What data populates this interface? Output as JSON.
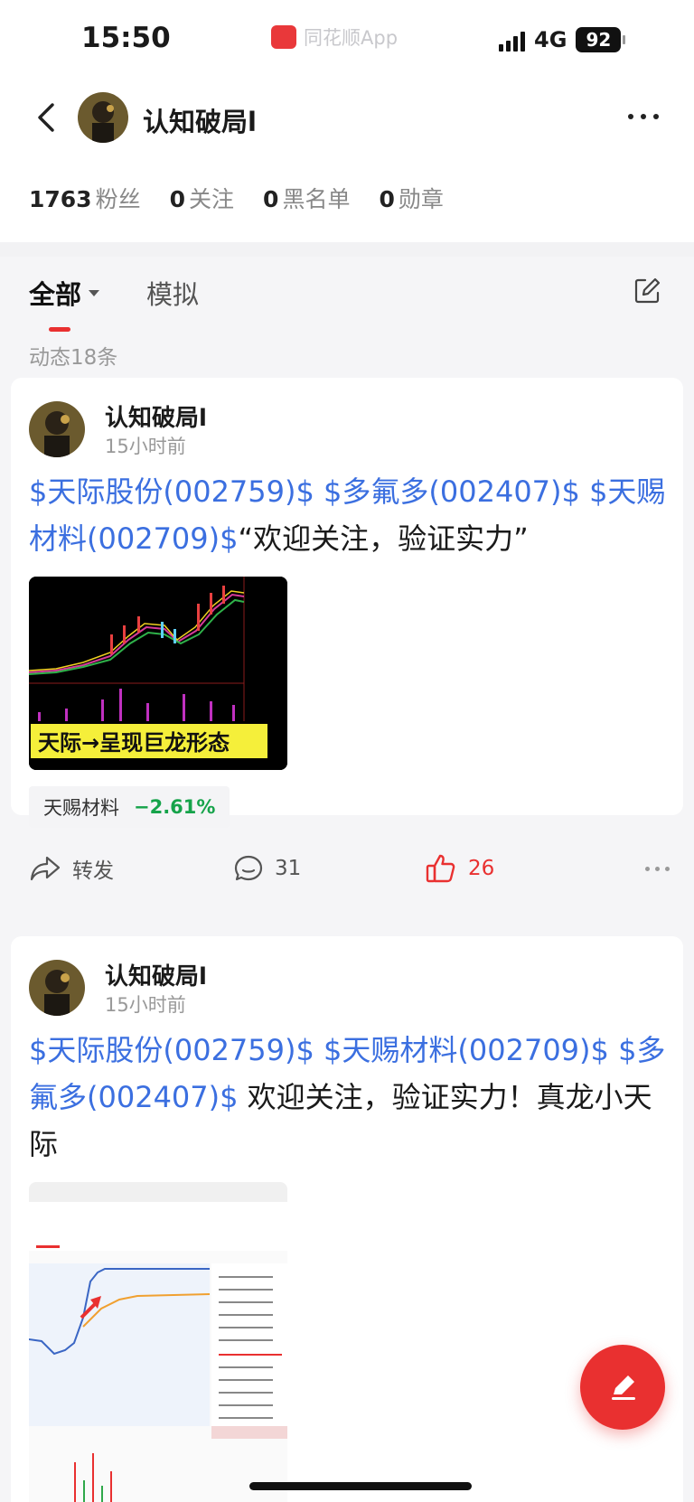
{
  "status_bar": {
    "time": "15:50",
    "app_label": "同花顺App",
    "network": "4G",
    "battery": "92"
  },
  "profile": {
    "name": "认知破局l",
    "stats": [
      {
        "value": "1763",
        "label": "粉丝"
      },
      {
        "value": "0",
        "label": "关注"
      },
      {
        "value": "0",
        "label": "黑名单"
      },
      {
        "value": "0",
        "label": "勋章"
      }
    ]
  },
  "tabs": {
    "all": "全部",
    "simulate": "模拟"
  },
  "feed_count": "动态18条",
  "posts": [
    {
      "author": "认知破局l",
      "time": "15小时前",
      "stocks": [
        "$天际股份(002759)$",
        "$多氟多(002407)$",
        "$天赐材料(002709)$"
      ],
      "text": "“欢迎关注，验证实力”",
      "image_caption": "天际→呈现巨龙形态",
      "tag": {
        "name": "天赐材料",
        "change": "−2.61%"
      },
      "actions": {
        "share": "转发",
        "comments": "31",
        "likes": "26"
      }
    },
    {
      "author": "认知破局l",
      "time": "15小时前",
      "stocks": [
        "$天际股份(002759)$",
        "$天赐材料(002709)$",
        "$多氟多(002407)$"
      ],
      "text": "欢迎关注，验证实力！真龙小天际"
    }
  ],
  "colors": {
    "accent": "#e93030",
    "link": "#3b6fe0",
    "down": "#16a34a"
  }
}
